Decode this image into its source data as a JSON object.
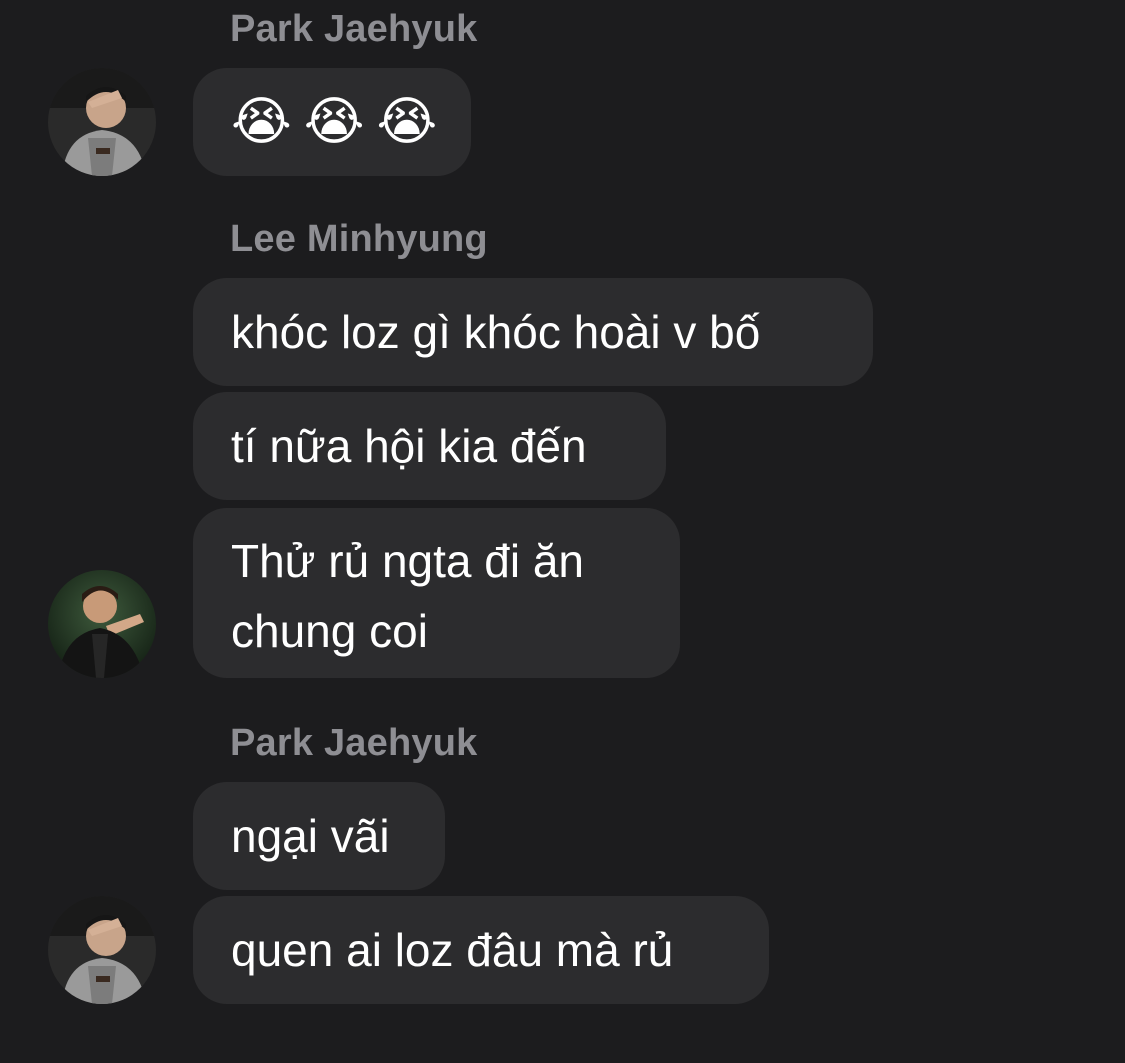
{
  "messages": [
    {
      "sender": "Park Jaehyuk",
      "bubbles": [
        {
          "type": "emoji",
          "emoji": [
            "😭",
            "😭",
            "😭"
          ],
          "icon": "loudly-crying-face-icon"
        }
      ]
    },
    {
      "sender": "Lee Minhyung",
      "bubbles": [
        {
          "type": "text",
          "text": "khóc loz gì khóc hoài v bố"
        },
        {
          "type": "text",
          "text": "tí nữa hội kia đến"
        },
        {
          "type": "text",
          "lines": [
            "Thử rủ ngta đi ăn",
            "chung coi"
          ]
        }
      ]
    },
    {
      "sender": "Park Jaehyuk",
      "bubbles": [
        {
          "type": "text",
          "text": "ngại vãi"
        },
        {
          "type": "text",
          "text": "quen ai loz đâu mà rủ"
        }
      ]
    }
  ],
  "colors": {
    "background": "#1c1c1e",
    "bubble": "#2c2c2e",
    "sender_name": "#8e8e93",
    "message_text": "#ffffff"
  }
}
